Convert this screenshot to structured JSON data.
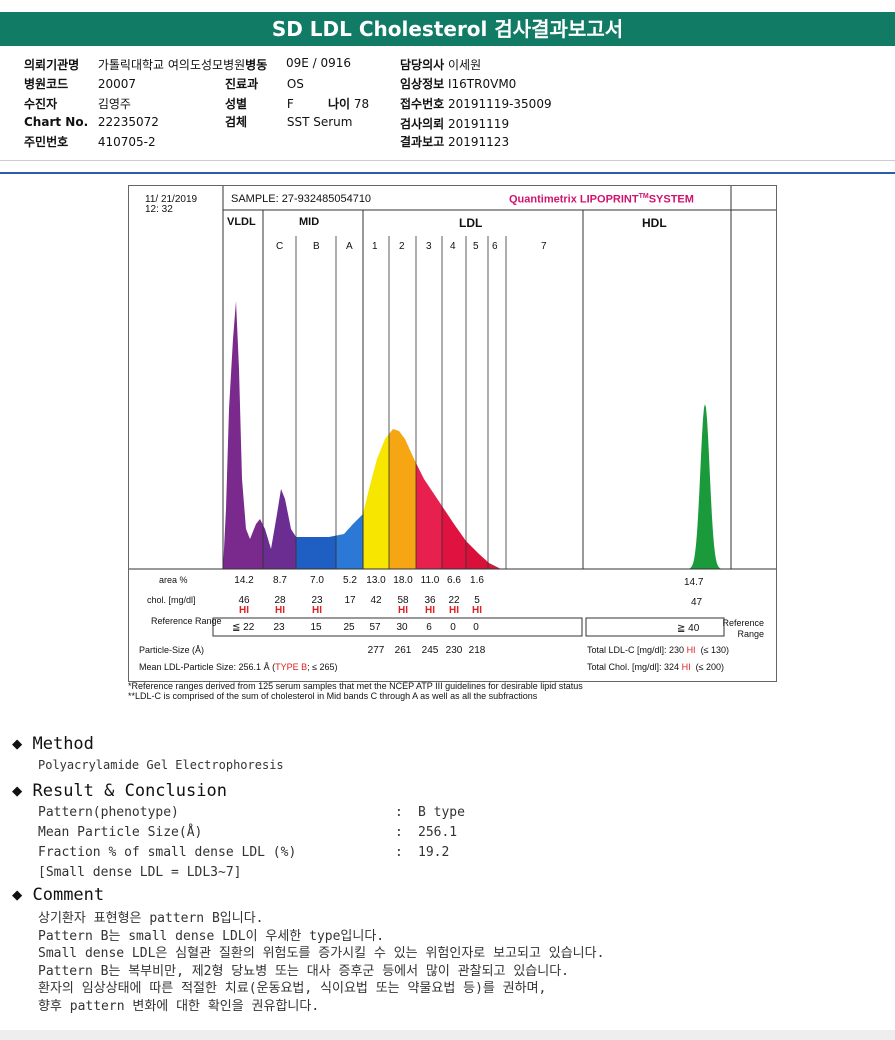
{
  "title": "SD LDL Cholesterol 검사결과보고서",
  "info": {
    "inst_label": "의뢰기관명",
    "inst": "가톨릭대학교 여의도성모병원",
    "ward_label": "병동",
    "ward": "09E / 0916",
    "doctor_label": "담당의사",
    "doctor": "이세원",
    "code_label": "병원코드",
    "code": "20007",
    "dept_label": "진료과",
    "dept": "OS",
    "clin_label": "임상정보",
    "clin": "I16TR0VM0",
    "patient_label": "수진자",
    "patient": "김영주",
    "sex_label": "성별",
    "sex": "F",
    "age_label": "나이",
    "age": "78",
    "recv_label": "접수번호",
    "recv": "20191119-35009",
    "chart_label": "Chart No.",
    "chart": "22235072",
    "spec_label": "검체",
    "spec": "SST Serum",
    "req_label": "검사의뢰",
    "req": "20191119",
    "id_label": "주민번호",
    "id": "410705-2",
    "rep_label": "결과보고",
    "rep": "20191123"
  },
  "report": {
    "date": "11/ 21/2019",
    "time": "12: 32",
    "sample": "SAMPLE:  27-932485054710",
    "brand": "Quantimetrix LIPOPRINT",
    "tm": "TM",
    "system": "SYSTEM",
    "groups": [
      "VLDL",
      "MID",
      "LDL",
      "HDL"
    ],
    "bands": [
      "C",
      "B",
      "A",
      "1",
      "2",
      "3",
      "4",
      "5",
      "6",
      "7"
    ],
    "area_label": "area %",
    "chol_label": "chol. [mg/dl]",
    "ref_label": "Reference Range",
    "ref_label_r": "Reference Range",
    "area": [
      "14.2",
      "8.7",
      "7.0",
      "5.2",
      "13.0",
      "18.0",
      "11.0",
      "6.6",
      "1.6"
    ],
    "chol": [
      "46",
      "28",
      "23",
      "17",
      "42",
      "58",
      "36",
      "22",
      "5"
    ],
    "hi": [
      "HI",
      "HI",
      "HI",
      "",
      "",
      "HI",
      "HI",
      "HI",
      "HI"
    ],
    "ref": [
      "≦ 22",
      "23",
      "15",
      "25",
      "57",
      "30",
      "6",
      "0",
      "0"
    ],
    "hdl_area": "14.7",
    "hdl_chol": "47",
    "hdl_ref": "≧ 40",
    "ps_label": "Particle-Size (Å)",
    "ps": [
      "277",
      "261",
      "245",
      "230",
      "218"
    ],
    "mean_label": "Mean LDL-Particle Size:  256.1 Å (",
    "mean_type": "TYPE B",
    "mean_end": "; ≤ 265)",
    "ldlc_label": "Total LDL-C [mg/dl]:  230",
    "ldlc_hi": "HI",
    "ldlc_ref": "(≤ 130)",
    "tc_label": "Total Chol. [mg/dl]:   324",
    "tc_hi": "HI",
    "tc_ref": "(≤ 200)",
    "note1": "*Reference ranges derived from 125 serum samples that met the NCEP ATP III guidelines for desirable lipid status",
    "note2": "**LDL-C is comprised of the sum of cholesterol in Mid bands C through A as well as all the subfractions",
    "colors": {
      "vldl": "#7a2a8c",
      "C": "#6b2d92",
      "B": "#1f5fc4",
      "A": "#2b78d6",
      "1": "#f6e600",
      "2": "#f5a612",
      "3": "#e8204e",
      "4": "#df1240",
      "5": "#d8103a",
      "6": "#cc1a3a",
      "hdl": "#1a9a3a"
    }
  },
  "method": {
    "heading": "Method",
    "text": "Polyacrylamide Gel Electrophoresis"
  },
  "result": {
    "heading": "Result & Conclusion",
    "rows": [
      {
        "label": "Pattern(phenotype)",
        "value": "B type"
      },
      {
        "label": "Mean Particle Size(Å)",
        "value": "256.1"
      },
      {
        "label": "Fraction % of small dense LDL (%)",
        "value": "19.2"
      }
    ],
    "note": "[Small dense LDL = LDL3~7]",
    "sep": ":"
  },
  "comment": {
    "heading": "Comment",
    "lines": [
      "상기환자 표현형은 pattern B입니다.",
      "Pattern B는 small dense LDL이 우세한 type입니다.",
      "Small dense LDL은 심혈관 질환의 위험도를 증가시킬 수 있는 위험인자로 보고되고 있습니다.",
      "Pattern B는 복부비만, 제2형 당뇨병 또는 대사 증후군 등에서 많이 관찰되고 있습니다.",
      "환자의 임상상태에 따른 적절한 치료(운동요법, 식이요법 또는 약물요법 등)를 권하며,",
      "향후 pattern 변화에 대한 확인을 권유합니다."
    ]
  }
}
